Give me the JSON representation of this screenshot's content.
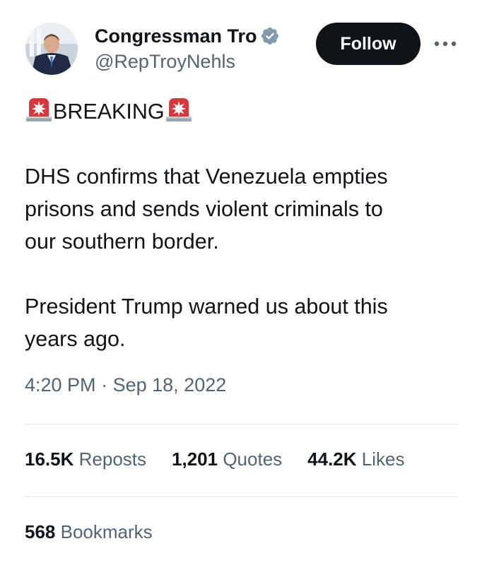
{
  "author": {
    "display_name": "Congressman Troy Nehls",
    "handle": "@RepTroyNehls",
    "verified_icon": "verified-badge-icon",
    "verified_color": "#829aab"
  },
  "follow_button": {
    "label": "Follow"
  },
  "more_menu": {
    "icon": "more-horizontal-icon"
  },
  "tweet": {
    "siren_icon": "police-car-light-emoji",
    "heading": "BREAKING",
    "lines": [
      "DHS confirms that Venezuela empties",
      "prisons and sends violent criminals to",
      "our southern border.",
      "President Trump warned us about this",
      "years ago."
    ],
    "time": "4:20 PM",
    "separator": "·",
    "date": "Sep 18, 2022"
  },
  "stats": {
    "reposts": {
      "count": "16.5K",
      "label": "Reposts"
    },
    "quotes": {
      "count": "1,201",
      "label": "Quotes"
    },
    "likes": {
      "count": "44.2K",
      "label": "Likes"
    },
    "bookmarks": {
      "count": "568",
      "label": "Bookmarks"
    }
  },
  "colors": {
    "text": "#0f1419",
    "secondary": "#536471",
    "button": "#0f1419",
    "divider": "#e6e9ec"
  }
}
